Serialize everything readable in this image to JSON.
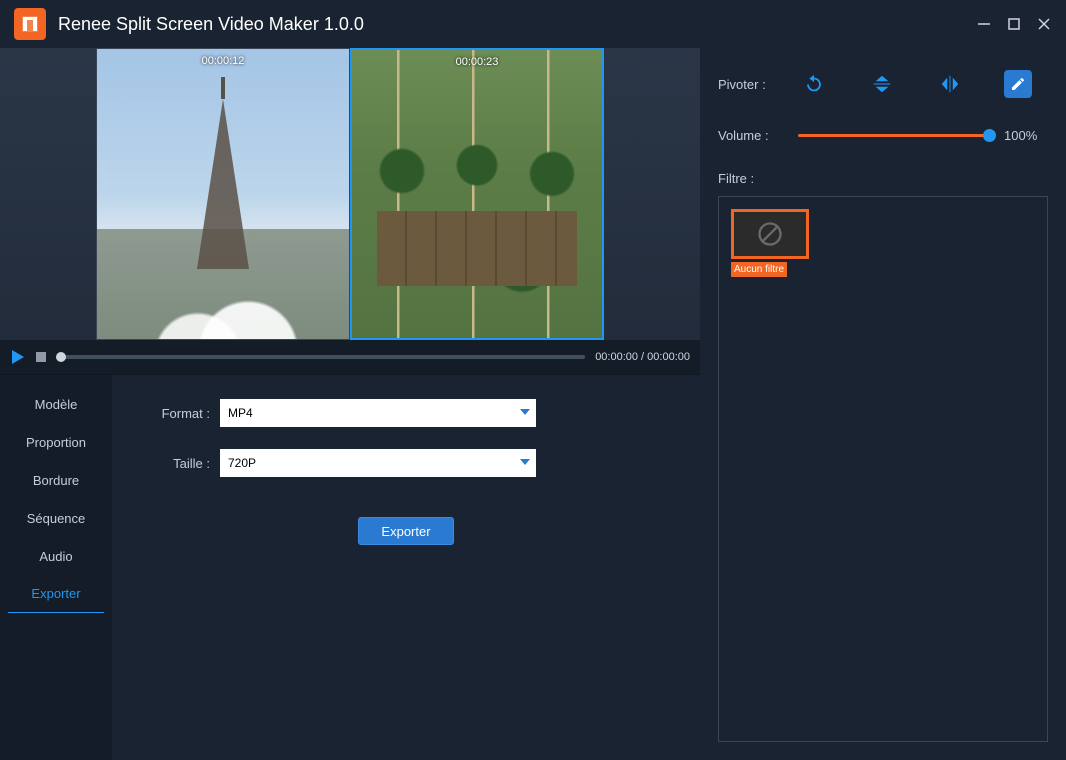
{
  "app": {
    "title": "Renee Split Screen Video Maker 1.0.0"
  },
  "preview": {
    "left_timestamp": "00:00:12",
    "right_timestamp": "00:00:23"
  },
  "playbar": {
    "time_display": "00:00:00 / 00:00:00"
  },
  "sidebar": {
    "items": [
      "Modèle",
      "Proportion",
      "Bordure",
      "Séquence",
      "Audio",
      "Exporter"
    ],
    "active_index": 5
  },
  "settings": {
    "format_label": "Format :",
    "format_value": "MP4",
    "size_label": "Taille :",
    "size_value": "720P",
    "export_button": "Exporter"
  },
  "right_panel": {
    "rotate_label": "Pivoter :",
    "volume_label": "Volume :",
    "volume_value": "100%",
    "filter_label": "Filtre :",
    "filter_none": "Aucun filtre"
  }
}
